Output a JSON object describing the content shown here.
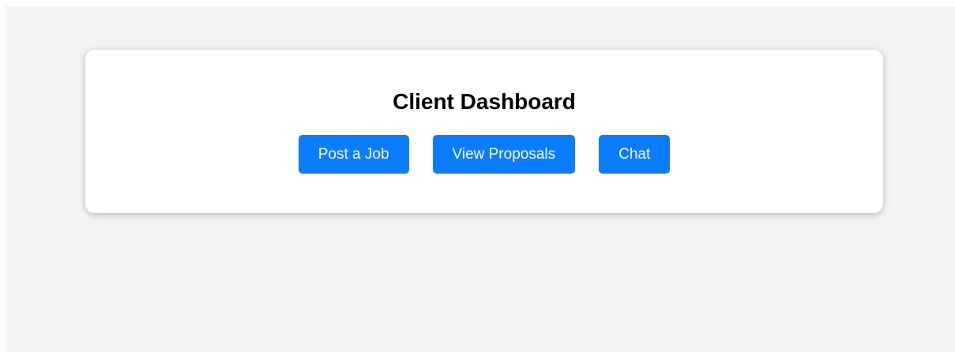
{
  "dashboard": {
    "title": "Client Dashboard",
    "buttons": {
      "post_job": "Post a Job",
      "view_proposals": "View Proposals",
      "chat": "Chat"
    },
    "colors": {
      "page_background": "#f3f3f3",
      "card_background": "#ffffff",
      "button_background": "#0a7cff",
      "button_text": "#ffffff"
    }
  }
}
